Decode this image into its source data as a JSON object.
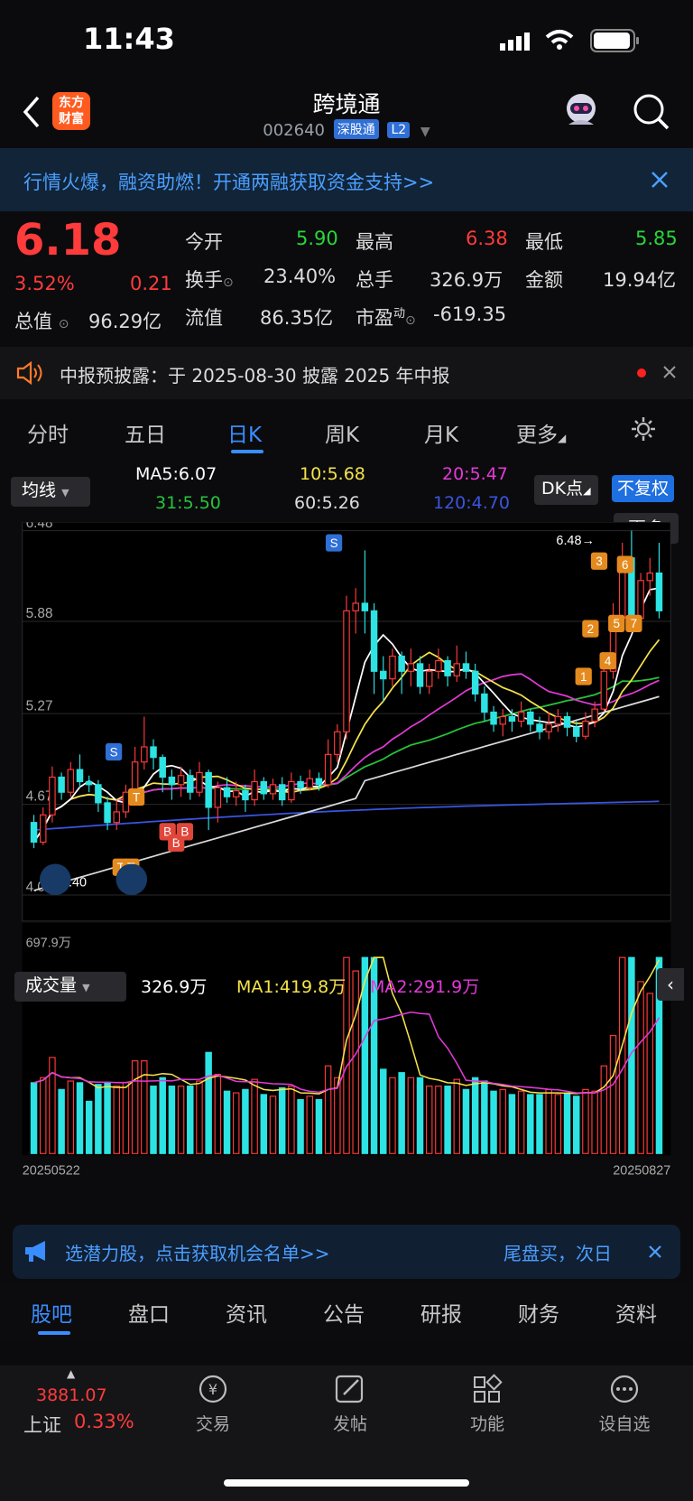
{
  "status": {
    "time": "11:43"
  },
  "header": {
    "title": "跨境通",
    "code": "002640",
    "tag1": "深股通",
    "tag2": "L2",
    "logo": "东方\n财富"
  },
  "banner": {
    "text": "行情火爆，融资助燃！开通两融获取资金支持>>"
  },
  "quote": {
    "price": "6.18",
    "pct": "3.52%",
    "chg": "0.21",
    "open_label": "今开",
    "open": "5.90",
    "high_label": "最高",
    "high": "6.38",
    "low_label": "最低",
    "low": "5.85",
    "turn_label": "换手",
    "turn": "23.40%",
    "vol_label": "总手",
    "vol": "326.9万",
    "amt_label": "金额",
    "amt": "19.94亿",
    "cap_label": "总值",
    "cap": "96.29亿",
    "float_label": "流值",
    "float": "86.35亿",
    "pe_label": "市盈",
    "pe_sup": "动",
    "pe": "-619.35",
    "more": "更多"
  },
  "notice": {
    "text": "中报预披露：于 2025-08-30 披露 2025 年中报"
  },
  "tabs": [
    "分时",
    "五日",
    "日K",
    "周K",
    "月K",
    "更多"
  ],
  "ma_row": {
    "select": "均线",
    "ma5": "MA5:6.07",
    "ma10": "10:5.68",
    "ma20": "20:5.47",
    "ma31": "31:5.50",
    "ma60": "60:5.26",
    "ma120": "120:4.70",
    "dk": "DK点",
    "fq": "不复权"
  },
  "chart_data": {
    "type": "candlestick",
    "yticks": [
      "6.48",
      "5.88",
      "5.27",
      "4.67",
      "4.07"
    ],
    "ylim": [
      4.07,
      6.48
    ],
    "max_label": "6.48",
    "min_label": "4.40",
    "xlabels": [
      "20250522",
      "20250827"
    ],
    "markers": [
      "S",
      "S",
      "T",
      "T",
      "T",
      "B",
      "B",
      "B",
      "1",
      "2",
      "3",
      "4",
      "5",
      "6",
      "7"
    ],
    "candles": [
      [
        4.55,
        4.42,
        4.6,
        4.38
      ],
      [
        4.42,
        4.6,
        4.65,
        4.4
      ],
      [
        4.6,
        4.85,
        4.92,
        4.55
      ],
      [
        4.85,
        4.75,
        4.88,
        4.7
      ],
      [
        4.75,
        4.9,
        4.95,
        4.72
      ],
      [
        4.9,
        4.82,
        5.0,
        4.78
      ],
      [
        4.82,
        4.8,
        4.86,
        4.75
      ],
      [
        4.8,
        4.68,
        4.83,
        4.62
      ],
      [
        4.68,
        4.55,
        4.72,
        4.5
      ],
      [
        4.55,
        4.62,
        4.7,
        4.5
      ],
      [
        4.62,
        4.75,
        4.8,
        4.58
      ],
      [
        4.75,
        4.95,
        5.05,
        4.7
      ],
      [
        4.95,
        5.05,
        5.25,
        4.9
      ],
      [
        5.05,
        4.98,
        5.1,
        4.9
      ],
      [
        4.98,
        4.85,
        5.0,
        4.75
      ],
      [
        4.85,
        4.8,
        4.9,
        4.7
      ],
      [
        4.8,
        4.86,
        4.92,
        4.72
      ],
      [
        4.86,
        4.75,
        4.9,
        4.7
      ],
      [
        4.75,
        4.88,
        4.95,
        4.72
      ],
      [
        4.88,
        4.65,
        4.9,
        4.5
      ],
      [
        4.65,
        4.78,
        4.82,
        4.55
      ],
      [
        4.78,
        4.72,
        4.85,
        4.68
      ],
      [
        4.72,
        4.76,
        4.82,
        4.66
      ],
      [
        4.76,
        4.7,
        4.8,
        4.62
      ],
      [
        4.7,
        4.82,
        4.9,
        4.66
      ],
      [
        4.82,
        4.74,
        4.85,
        4.7
      ],
      [
        4.74,
        4.8,
        4.84,
        4.7
      ],
      [
        4.8,
        4.7,
        4.85,
        4.66
      ],
      [
        4.7,
        4.82,
        4.88,
        4.68
      ],
      [
        4.82,
        4.78,
        4.86,
        4.74
      ],
      [
        4.78,
        4.84,
        4.9,
        4.76
      ],
      [
        4.84,
        4.8,
        4.88,
        4.76
      ],
      [
        4.8,
        5.0,
        5.1,
        4.78
      ],
      [
        5.0,
        5.15,
        5.2,
        4.95
      ],
      [
        5.15,
        5.95,
        6.05,
        5.1
      ],
      [
        5.95,
        6.0,
        6.1,
        5.8
      ],
      [
        6.0,
        5.95,
        6.35,
        5.8
      ],
      [
        5.95,
        5.55,
        6.0,
        5.4
      ],
      [
        5.55,
        5.5,
        5.65,
        5.35
      ],
      [
        5.5,
        5.65,
        5.7,
        5.45
      ],
      [
        5.65,
        5.55,
        5.68,
        5.4
      ],
      [
        5.55,
        5.6,
        5.7,
        5.45
      ],
      [
        5.6,
        5.45,
        5.65,
        5.4
      ],
      [
        5.45,
        5.55,
        5.6,
        5.4
      ],
      [
        5.55,
        5.62,
        5.7,
        5.5
      ],
      [
        5.62,
        5.52,
        5.65,
        5.45
      ],
      [
        5.52,
        5.6,
        5.72,
        5.48
      ],
      [
        5.6,
        5.55,
        5.68,
        5.5
      ],
      [
        5.55,
        5.4,
        5.6,
        5.35
      ],
      [
        5.4,
        5.28,
        5.45,
        5.22
      ],
      [
        5.28,
        5.2,
        5.32,
        5.15
      ],
      [
        5.2,
        5.25,
        5.3,
        5.12
      ],
      [
        5.25,
        5.22,
        5.3,
        5.15
      ],
      [
        5.22,
        5.28,
        5.35,
        5.18
      ],
      [
        5.28,
        5.2,
        5.3,
        5.15
      ],
      [
        5.2,
        5.15,
        5.25,
        5.1
      ],
      [
        5.15,
        5.2,
        5.28,
        5.1
      ],
      [
        5.2,
        5.25,
        5.3,
        5.15
      ],
      [
        5.25,
        5.18,
        5.28,
        5.12
      ],
      [
        5.18,
        5.12,
        5.22,
        5.08
      ],
      [
        5.12,
        5.22,
        5.28,
        5.1
      ],
      [
        5.22,
        5.3,
        5.35,
        5.18
      ],
      [
        5.3,
        5.55,
        5.6,
        5.28
      ],
      [
        5.55,
        5.9,
        6.0,
        5.5
      ],
      [
        5.9,
        6.3,
        6.4,
        5.85
      ],
      [
        6.3,
        5.9,
        6.48,
        5.85
      ],
      [
        5.9,
        6.15,
        6.2,
        5.88
      ],
      [
        6.15,
        6.2,
        6.3,
        6.05
      ],
      [
        6.2,
        5.95,
        6.4,
        5.9
      ]
    ]
  },
  "volume": {
    "select": "成交量",
    "vol": "326.9万",
    "ma1": "MA1:419.8万",
    "ma2": "MA2:291.9万",
    "max_label": "697.9万"
  },
  "bottom_banner": {
    "left": "选潜力股，点击获取机会名单>>",
    "right": "尾盘买，次日"
  },
  "bottom_tabs": [
    "股吧",
    "盘口",
    "资讯",
    "公告",
    "研报",
    "财务",
    "资料"
  ],
  "nav": {
    "index_value": "3881.07",
    "index_name": "上证",
    "index_pct": "0.33%",
    "items": [
      "交易",
      "发帖",
      "功能",
      "设自选"
    ]
  }
}
